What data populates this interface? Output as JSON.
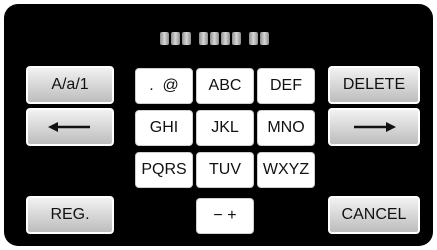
{
  "display": {
    "placeholder_groups": [
      3,
      4,
      2
    ]
  },
  "keys": {
    "mode": "A/a/1",
    "punct": ".  @",
    "abc": "ABC",
    "def": "DEF",
    "delete": "DELETE",
    "ghi": "GHI",
    "jkl": "JKL",
    "mno": "MNO",
    "pqrs": "PQRS",
    "tuv": "TUV",
    "wxyz": "WXYZ",
    "reg": "REG.",
    "minus_plus": "− +",
    "cancel": "CANCEL"
  },
  "icons": {
    "left": "arrow-left-icon",
    "right": "arrow-right-icon"
  }
}
